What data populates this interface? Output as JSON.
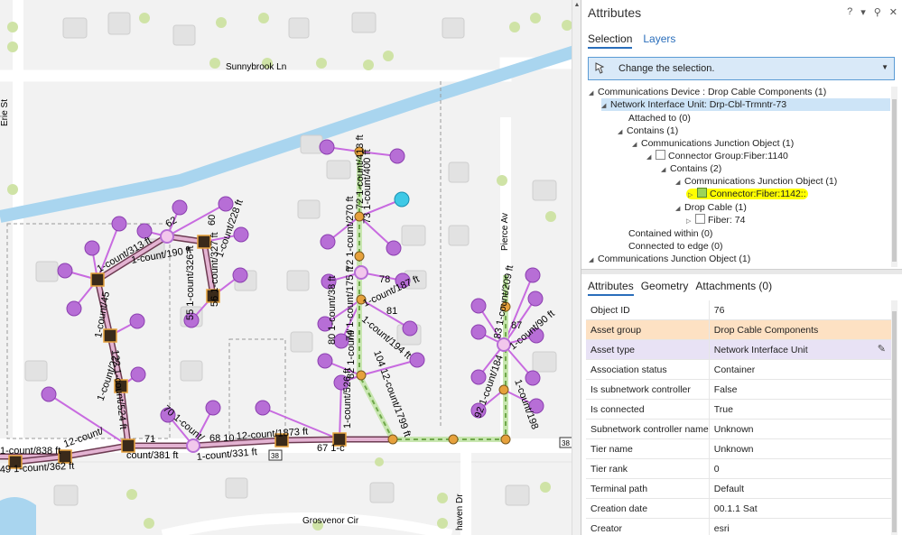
{
  "map": {
    "street_labels": [
      "Sunnybrook Ln",
      "Grosvenor Cir",
      "Pierce Av",
      "Erie St",
      "haven Dr"
    ],
    "route_shields": [
      "38",
      "38"
    ],
    "length_labels": [
      "72 1-count/413 ft",
      "72 1-count/270 ft",
      "73 1-count/400 ft",
      "74 1-count/175 ft",
      "1-count/187 ft",
      "80 1-count/38 ft",
      "1-count/194 ft",
      "82 1-count/",
      "104 12-count/1799 ft",
      "1-count/526 ft",
      "67 1-c",
      "12-count/1873 ft",
      "1-count/331 ft",
      "68 10",
      "70 1-count/",
      "71",
      "count/381 ft",
      "122 1-count/524 ft",
      "1-count/313 ft",
      "1-count/190 ft",
      "1-count/228 ft",
      "56 1-count/327 ft",
      "55 1-count/326 ft",
      "1-count/838 ft",
      "12-count/",
      "49 1-count/362 ft",
      "83 1-count/209 ft",
      "1-count/90 ft",
      "92 1-count/184",
      "1-count/198",
      "62",
      "60",
      "78",
      "81",
      "87",
      "1-count/45",
      "1-count/22"
    ],
    "colors": {
      "cable": "#d9a3c6",
      "cable_outline": "#6d3b52",
      "drop": "#c86be0",
      "device": "#b76ed6",
      "fiber_dash": "#7fbf5a",
      "connector": "#e6a13c",
      "water": "#a9d5ef",
      "road": "#ffffff",
      "highlight_device": "#3ec9e6"
    }
  },
  "panel": {
    "title": "Attributes",
    "controls": {
      "help": "?",
      "menu": "▾",
      "pin": "⚲",
      "close": "✕"
    },
    "tabs": {
      "selection": "Selection",
      "layers": "Layers"
    },
    "dropdown_label": "Change the selection.",
    "tree": [
      {
        "label": "Communications Device : Drop Cable Components (1)",
        "expanded": true
      },
      {
        "label": "Network Interface Unit: Drp-Cbl-Trmntr-73",
        "expanded": true,
        "selected": true
      },
      {
        "label": "Attached to (0)"
      },
      {
        "label": "Contains (1)",
        "expanded": true
      },
      {
        "label": "Communications Junction Object (1)",
        "expanded": true
      },
      {
        "label": "Connector Group:Fiber:1140",
        "expanded": true
      },
      {
        "label": "Contains (2)",
        "expanded": true
      },
      {
        "label": "Communications Junction Object (1)",
        "expanded": true
      },
      {
        "label": "Connector:Fiber:1142::",
        "highlighted": true
      },
      {
        "label": "Drop Cable (1)",
        "expanded": true
      },
      {
        "label": "Fiber: 74"
      },
      {
        "label": "Contained within (0)"
      },
      {
        "label": "Connected to edge (0)"
      },
      {
        "label": "Communications Junction Object (1)",
        "expanded": true
      }
    ],
    "sub_tabs": {
      "attributes": "Attributes",
      "geometry": "Geometry",
      "attachments": "Attachments (0)"
    },
    "attributes": [
      {
        "key": "Object ID",
        "value": "76"
      },
      {
        "key": "Asset group",
        "value": "Drop Cable Components"
      },
      {
        "key": "Asset type",
        "value": "Network Interface Unit"
      },
      {
        "key": "Association status",
        "value": "Container"
      },
      {
        "key": "Is subnetwork controller",
        "value": "False"
      },
      {
        "key": "Is connected",
        "value": "True"
      },
      {
        "key": "Subnetwork controller name",
        "value": "Unknown"
      },
      {
        "key": "Tier name",
        "value": "Unknown"
      },
      {
        "key": "Tier rank",
        "value": "0"
      },
      {
        "key": "Terminal path",
        "value": "Default"
      },
      {
        "key": "Creation date",
        "value": "00.1.1 Sat"
      },
      {
        "key": "Creator",
        "value": "esri"
      }
    ]
  }
}
